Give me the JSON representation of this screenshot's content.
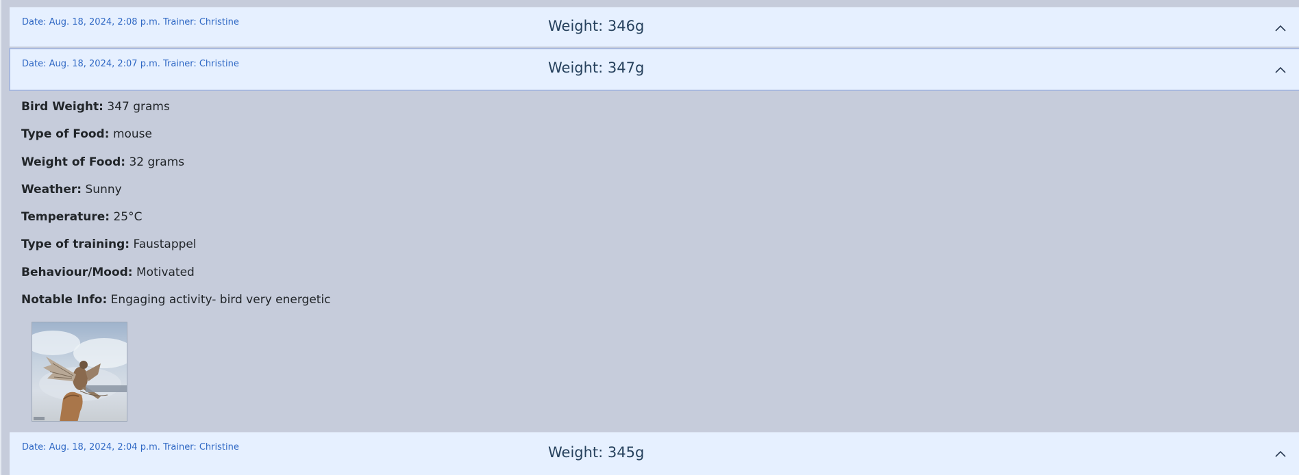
{
  "entries": [
    {
      "meta": "Date: Aug. 18, 2024, 2:08 p.m. Trainer: Christine",
      "weight": "Weight: 346g",
      "expanded": false
    },
    {
      "meta": "Date: Aug. 18, 2024, 2:07 p.m. Trainer: Christine",
      "weight": "Weight: 347g",
      "expanded": true,
      "details": {
        "bird_weight_label": "Bird Weight:",
        "bird_weight_value": "347 grams",
        "food_type_label": "Type of Food:",
        "food_type_value": "mouse",
        "food_weight_label": "Weight of Food:",
        "food_weight_value": "32 grams",
        "weather_label": "Weather:",
        "weather_value": "Sunny",
        "temperature_label": "Temperature:",
        "temperature_value": "25°C",
        "training_label": "Type of training:",
        "training_value": "Faustappel",
        "mood_label": "Behaviour/Mood:",
        "mood_value": "Motivated",
        "notes_label": "Notable Info:",
        "notes_value": "Engaging activity- bird very energetic"
      },
      "photo_icon": "bird-photo"
    },
    {
      "meta": "Date: Aug. 18, 2024, 2:04 p.m. Trainer: Christine",
      "weight": "Weight: 345g",
      "expanded": false
    }
  ],
  "colors": {
    "page_bg": "#c6ccdb",
    "header_bg": "#e6f0ff",
    "meta_text": "#2e67c4",
    "weight_text": "#26415d",
    "active_border": "#a9b9de"
  },
  "icons": {
    "toggle": "chevron-up-icon"
  }
}
